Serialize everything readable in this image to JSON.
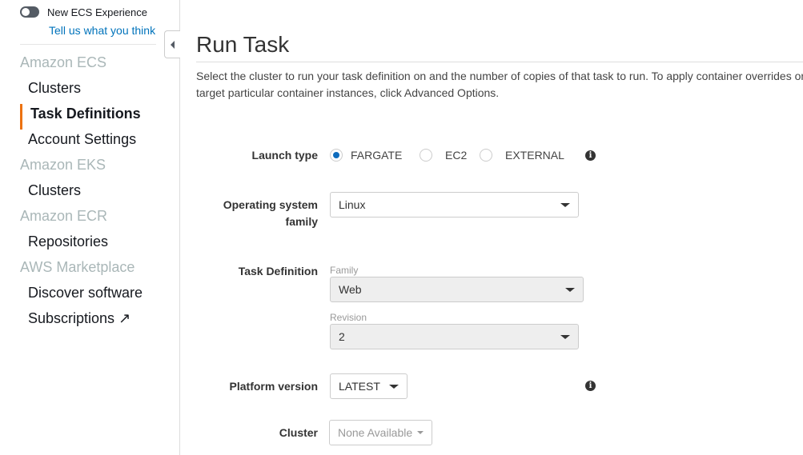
{
  "sidebar": {
    "new_experience": "New ECS Experience",
    "feedback": "Tell us what you think",
    "groups": [
      {
        "title": "Amazon ECS",
        "items": [
          "Clusters",
          "Task Definitions",
          "Account Settings"
        ]
      },
      {
        "title": "Amazon EKS",
        "items": [
          "Clusters"
        ]
      },
      {
        "title": "Amazon ECR",
        "items": [
          "Repositories"
        ]
      },
      {
        "title": "AWS Marketplace",
        "items": [
          "Discover software",
          "Subscriptions"
        ]
      }
    ],
    "active": "Task Definitions"
  },
  "main": {
    "title": "Run Task",
    "description_1": "Select the cluster to run your task definition on and the number of copies of that task to run. To apply container overrides or",
    "description_2": "target particular container instances, click Advanced Options.",
    "launch_type": {
      "label": "Launch type",
      "options": [
        "FARGATE",
        "EC2",
        "EXTERNAL"
      ],
      "selected": "FARGATE"
    },
    "os_family": {
      "label_1": "Operating system",
      "label_2": "family",
      "value": "Linux"
    },
    "task_definition": {
      "label": "Task Definition",
      "family_label": "Family",
      "family_value": "Web",
      "revision_label": "Revision",
      "revision_value": "2"
    },
    "platform_version": {
      "label": "Platform version",
      "value": "LATEST"
    },
    "cluster": {
      "label": "Cluster",
      "value": "None Available"
    }
  },
  "colors": {
    "accent": "#ec7211",
    "link": "#0073bb",
    "radio": "#0f6cbd"
  }
}
